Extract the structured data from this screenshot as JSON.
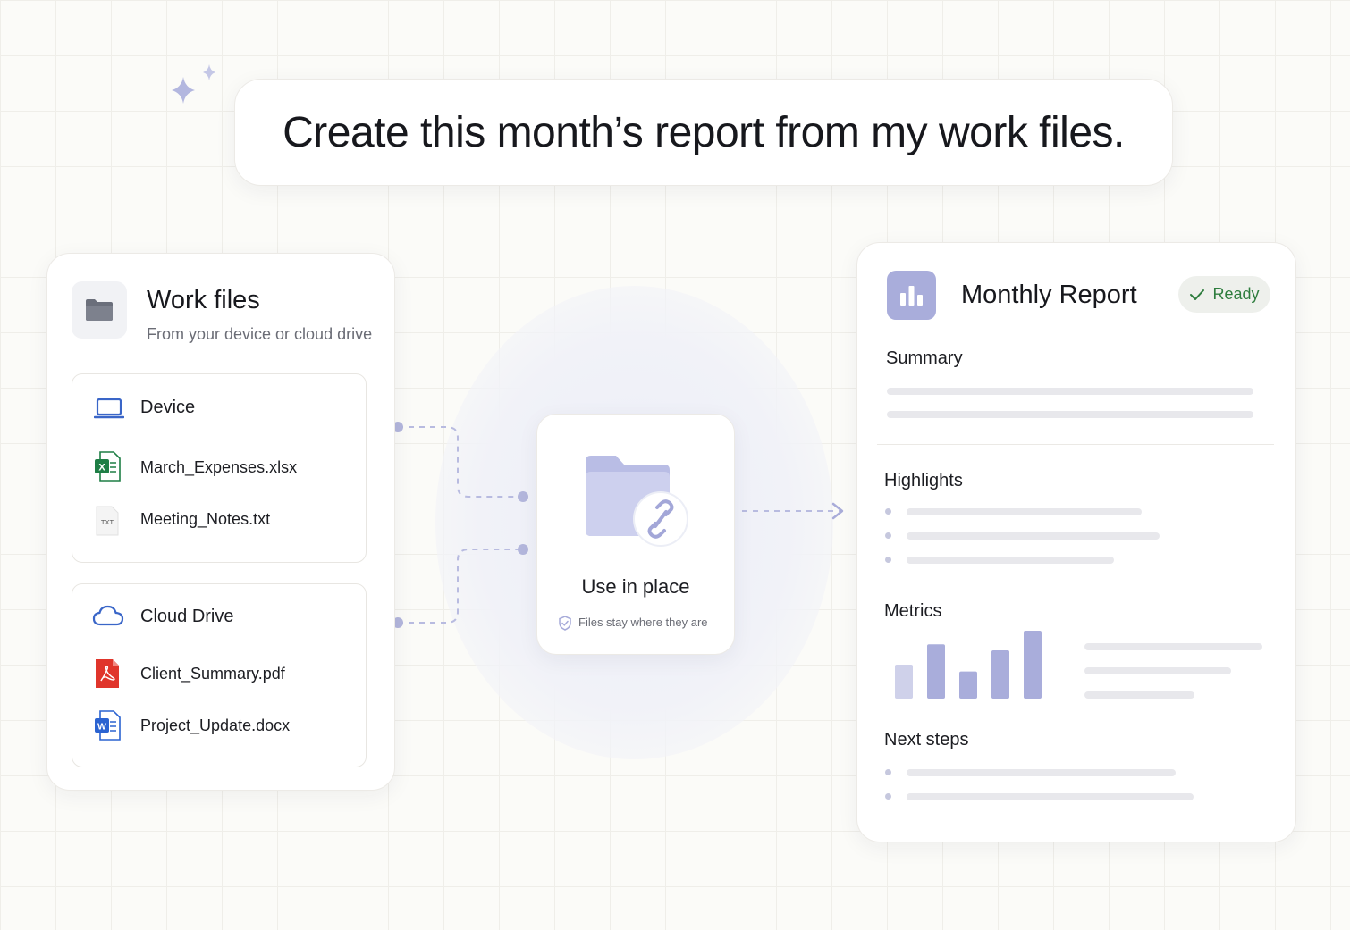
{
  "prompt": {
    "text": "Create this month’s report from my work files."
  },
  "work_files": {
    "title": "Work files",
    "subtitle": "From your device or cloud drive",
    "groups": [
      {
        "title": "Device",
        "icon": "laptop-icon",
        "files": [
          {
            "name": "March_Expenses.xlsx",
            "icon": "excel-file-icon"
          },
          {
            "name": "Meeting_Notes.txt",
            "icon": "txt-file-icon",
            "badge": "TXT"
          }
        ]
      },
      {
        "title": "Cloud Drive",
        "icon": "cloud-icon",
        "files": [
          {
            "name": "Client_Summary.pdf",
            "icon": "pdf-file-icon"
          },
          {
            "name": "Project_Update.docx",
            "icon": "word-file-icon"
          }
        ]
      }
    ]
  },
  "center": {
    "title": "Use in place",
    "subtitle": "Files stay where they are",
    "icon": "linked-folder-icon"
  },
  "report": {
    "title": "Monthly Report",
    "status": "Ready",
    "sections": {
      "summary": "Summary",
      "highlights": "Highlights",
      "metrics": "Metrics",
      "next_steps": "Next steps"
    },
    "metrics_bars_relative": [
      0.5,
      0.8,
      0.4,
      0.71,
      1.0
    ]
  },
  "colors": {
    "accent": "#a9addb",
    "connector": "#b8bbe0",
    "ready_green": "#2e7d3e",
    "excel_green": "#1e7e45",
    "pdf_red": "#e0352b",
    "word_blue": "#2b63d1",
    "device_blue": "#3a66c8"
  }
}
